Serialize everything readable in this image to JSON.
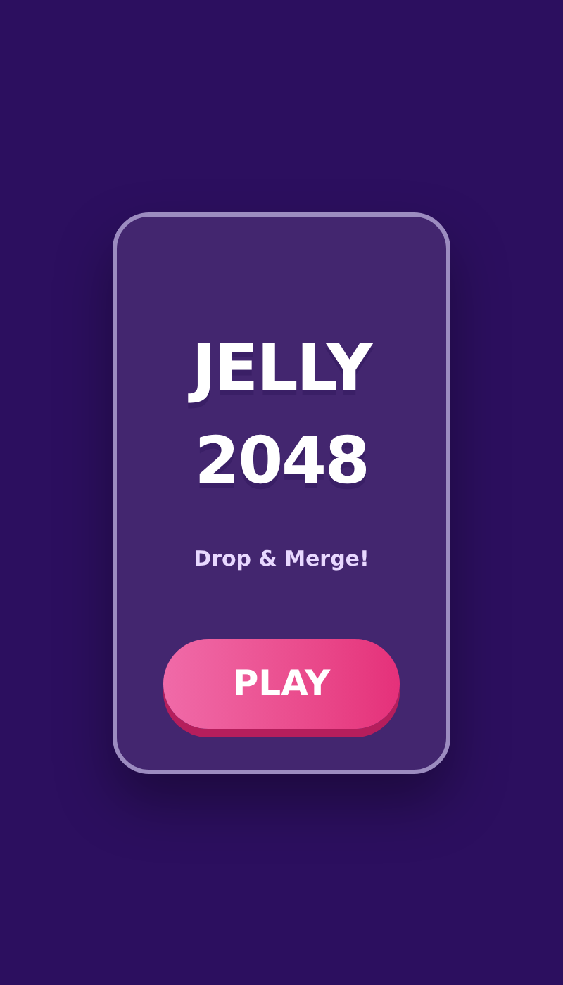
{
  "card": {
    "title": "JELLY 2048",
    "subtitle": "Drop & Merge!",
    "button": {
      "label": "PLAY"
    }
  }
}
